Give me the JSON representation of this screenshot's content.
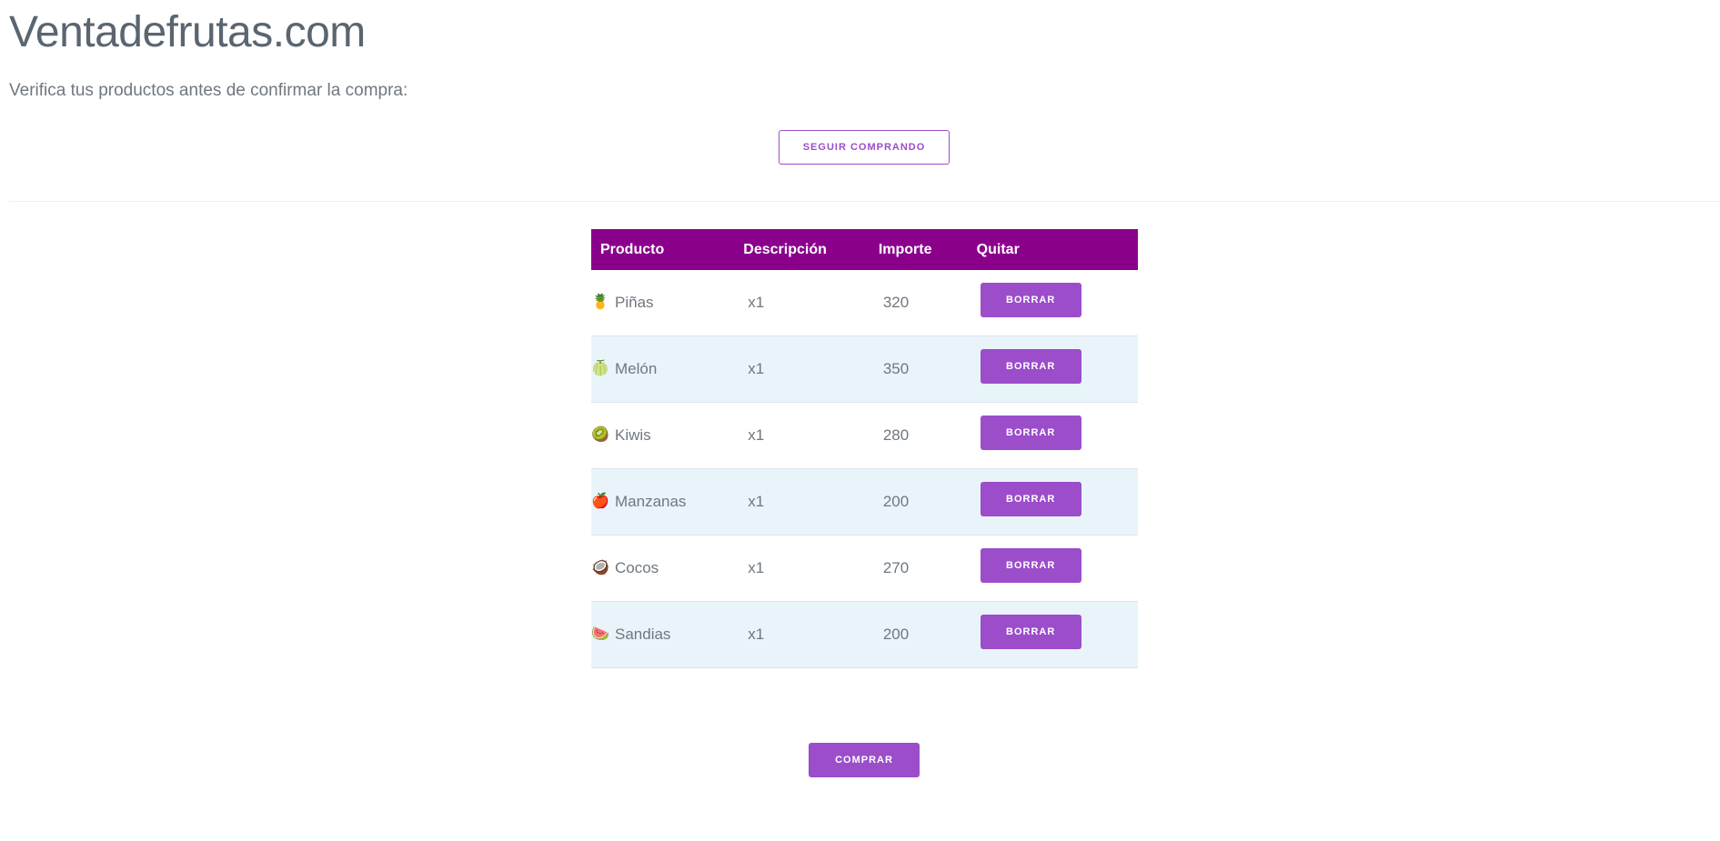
{
  "header": {
    "title": "Ventadefrutas.com",
    "subtitle": "Verifica tus productos antes de confirmar la compra:",
    "continue_label": "SEGUIR COMPRANDO"
  },
  "table": {
    "headers": [
      "Producto",
      "Descripción",
      "Importe",
      "Quitar"
    ],
    "rows": [
      {
        "icon": "pineapple-icon",
        "glyph": "🍍",
        "product": "Piñas",
        "description": "x1",
        "amount": "320",
        "action": "BORRAR"
      },
      {
        "icon": "melon-icon",
        "glyph": "🍈",
        "product": "Melón",
        "description": "x1",
        "amount": "350",
        "action": "BORRAR"
      },
      {
        "icon": "kiwi-icon",
        "glyph": "🥝",
        "product": "Kiwis",
        "description": "x1",
        "amount": "280",
        "action": "BORRAR"
      },
      {
        "icon": "apple-icon",
        "glyph": "🍎",
        "product": "Manzanas",
        "description": "x1",
        "amount": "200",
        "action": "BORRAR"
      },
      {
        "icon": "coconut-icon",
        "glyph": "🥥",
        "product": "Cocos",
        "description": "x1",
        "amount": "270",
        "action": "BORRAR"
      },
      {
        "icon": "watermelon-icon",
        "glyph": "🍉",
        "product": "Sandias",
        "description": "x1",
        "amount": "200",
        "action": "BORRAR"
      }
    ]
  },
  "footer": {
    "buy_label": "COMPRAR"
  },
  "colors": {
    "accent": "#9b4dca",
    "header_bg": "#8b008b",
    "row_alt_bg": "#e8f4fa"
  }
}
